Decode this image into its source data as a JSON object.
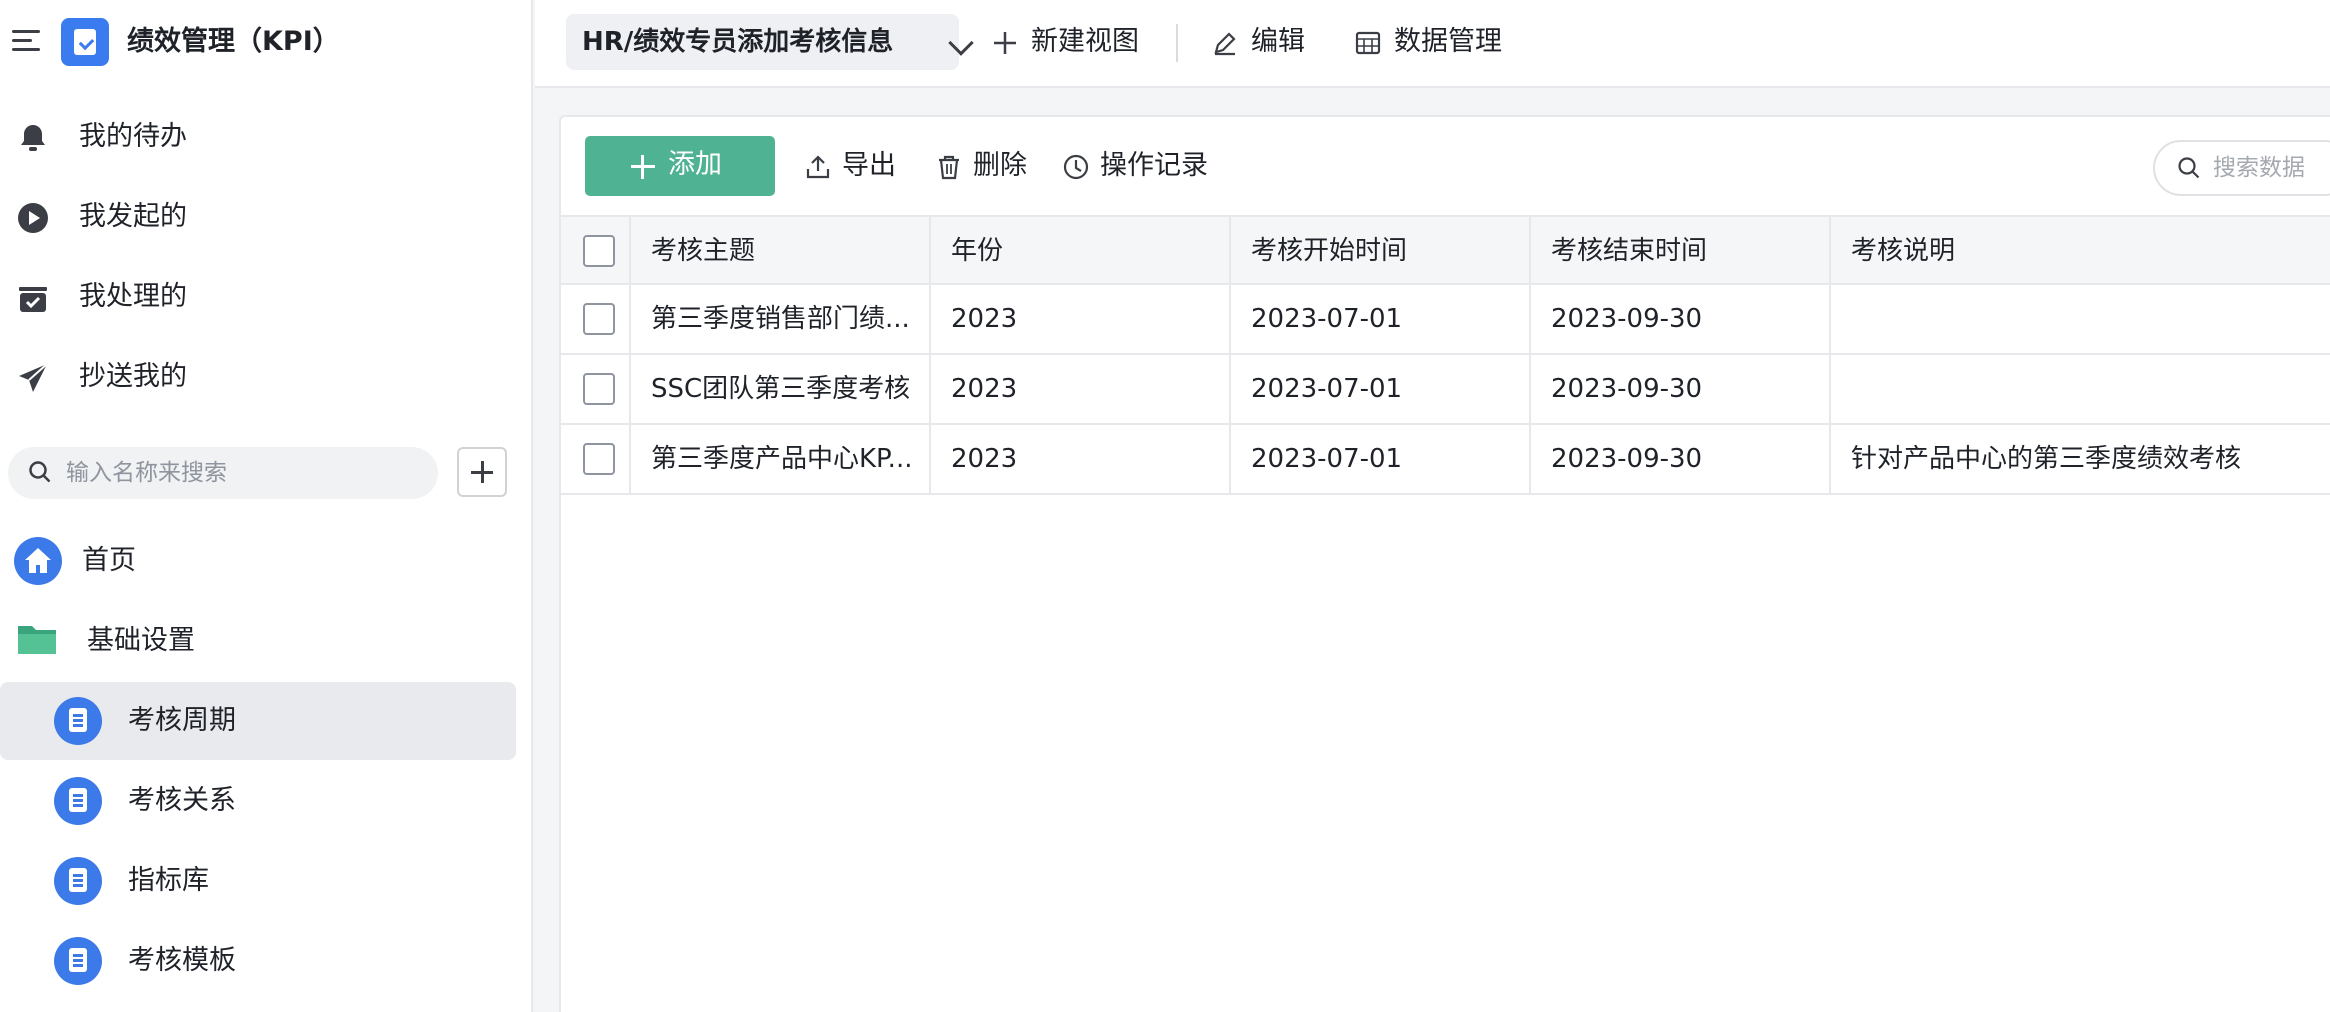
{
  "app": {
    "title": "绩效管理（KPI）"
  },
  "sidebar": {
    "nav": [
      {
        "label": "我的待办",
        "icon": "bell-icon"
      },
      {
        "label": "我发起的",
        "icon": "play-circle-icon"
      },
      {
        "label": "我处理的",
        "icon": "inbox-check-icon"
      },
      {
        "label": "抄送我的",
        "icon": "send-icon"
      }
    ],
    "search": {
      "placeholder": "输入名称来搜索",
      "value": ""
    },
    "tree": [
      {
        "label": "首页",
        "icon": "home-icon"
      },
      {
        "label": "基础设置",
        "icon": "folder-icon"
      },
      {
        "label": "考核周期",
        "icon": "document-icon",
        "active": true
      },
      {
        "label": "考核关系",
        "icon": "document-icon"
      },
      {
        "label": "指标库",
        "icon": "document-icon"
      },
      {
        "label": "考核模板",
        "icon": "document-icon"
      }
    ]
  },
  "topbar": {
    "view_label": "HR/绩效专员添加考核信息",
    "new_view": "新建视图",
    "edit": "编辑",
    "data_manage": "数据管理"
  },
  "toolbar": {
    "add": "添加",
    "export": "导出",
    "delete": "删除",
    "history": "操作记录",
    "search_placeholder": "搜索数据"
  },
  "table": {
    "columns": [
      "考核主题",
      "年份",
      "考核开始时间",
      "考核结束时间",
      "考核说明"
    ],
    "rows": [
      [
        "第三季度销售部门绩...",
        "2023",
        "2023-07-01",
        "2023-09-30",
        ""
      ],
      [
        "SSC团队第三季度考核",
        "2023",
        "2023-07-01",
        "2023-09-30",
        ""
      ],
      [
        "第三季度产品中心KP...",
        "2023",
        "2023-07-01",
        "2023-09-30",
        "针对产品中心的第三季度绩效考核"
      ]
    ]
  },
  "colors": {
    "accent": "#4fb393",
    "brand": "#3a7bf0",
    "active_bg": "#e9eaed"
  }
}
